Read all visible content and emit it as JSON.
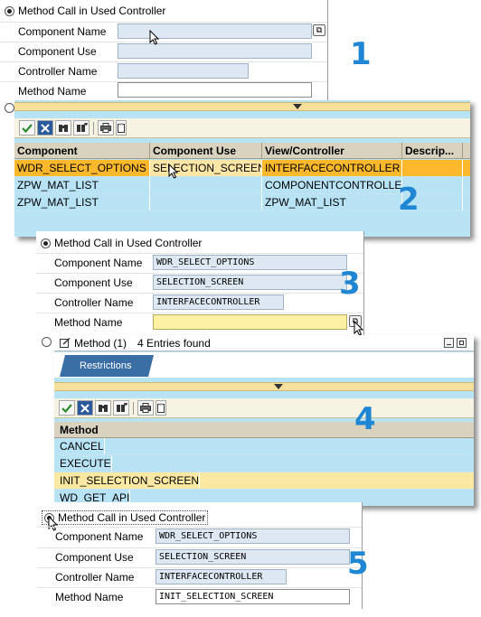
{
  "panel1": {
    "radio_label": "Method Call in Used Controller",
    "fields": [
      {
        "label": "Component Name",
        "value": ""
      },
      {
        "label": "Component Use",
        "value": ""
      },
      {
        "label": "Controller Name",
        "value": ""
      },
      {
        "label": "Method Name",
        "value": ""
      }
    ],
    "step_number": "1"
  },
  "panel2": {
    "columns": [
      "Component",
      "Component Use",
      "View/Controller",
      "Descrip..."
    ],
    "rows": [
      [
        "WDR_SELECT_OPTIONS",
        "SELECTION_SCREEN",
        "INTERFACECONTROLLER",
        ""
      ],
      [
        "ZPW_MAT_LIST",
        "",
        "COMPONENTCONTROLLER",
        ""
      ],
      [
        "ZPW_MAT_LIST",
        "",
        "ZPW_MAT_LIST",
        ""
      ]
    ],
    "step_number": "2"
  },
  "panel3": {
    "radio_label": "Method Call in Used Controller",
    "fields": [
      {
        "label": "Component Name",
        "value": "WDR_SELECT_OPTIONS"
      },
      {
        "label": "Component Use",
        "value": "SELECTION_SCREEN"
      },
      {
        "label": "Controller Name",
        "value": "INTERFACECONTROLLER"
      },
      {
        "label": "Method Name",
        "value": ""
      }
    ],
    "step_number": "3"
  },
  "panel4": {
    "title": "Method (1)",
    "entries_found": "4 Entries found",
    "tab_label": "Restrictions",
    "column": "Method",
    "rows": [
      "CANCEL",
      "EXECUTE",
      "INIT_SELECTION_SCREEN",
      "WD_GET_API"
    ],
    "step_number": "4"
  },
  "panel5": {
    "radio_label": "Method Call in Used Controller",
    "fields": [
      {
        "label": "Component Name",
        "value": "WDR_SELECT_OPTIONS"
      },
      {
        "label": "Component Use",
        "value": "SELECTION_SCREEN"
      },
      {
        "label": "Controller Name",
        "value": "INTERFACECONTROLLER"
      },
      {
        "label": "Method Name",
        "value": "INIT_SELECTION_SCREEN"
      }
    ],
    "step_number": "5"
  },
  "colors": {
    "accent_number": "#1f86d4",
    "row_blue": "#b8e3f5",
    "row_orange": "#fdb92b",
    "row_selected": "#fbe9a3",
    "field_blue": "#dde8f2"
  }
}
